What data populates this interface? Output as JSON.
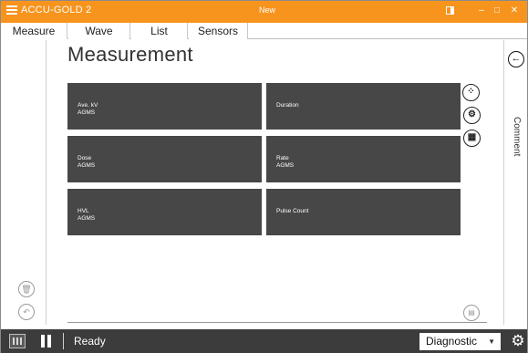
{
  "window": {
    "app_title": "ACCU-GOLD 2",
    "document_title": "New",
    "accent_color": "#f7941d"
  },
  "tabs": [
    {
      "label": "Measure",
      "active": true
    },
    {
      "label": "Wave",
      "active": false
    },
    {
      "label": "List",
      "active": false
    },
    {
      "label": "Sensors",
      "active": false
    }
  ],
  "main": {
    "title": "Measurement",
    "tiles": [
      {
        "title": "Ave. kV",
        "subtitle": "AGMS"
      },
      {
        "title": "Duration",
        "subtitle": ""
      },
      {
        "title": "Dose",
        "subtitle": "AGMS"
      },
      {
        "title": "Rate",
        "subtitle": "AGMS"
      },
      {
        "title": "HVL",
        "subtitle": "AGMS"
      },
      {
        "title": "Pulse Count",
        "subtitle": ""
      }
    ],
    "tile_color": "#474747"
  },
  "right_panel": {
    "comment_label": "Comment"
  },
  "status_bar": {
    "status": "Ready",
    "mode_select": "Diagnostic",
    "background": "#3c3c3c"
  },
  "icons": {
    "menu": "hamburger-icon",
    "back": "arrow-left-icon",
    "settings": "gear-icon"
  }
}
